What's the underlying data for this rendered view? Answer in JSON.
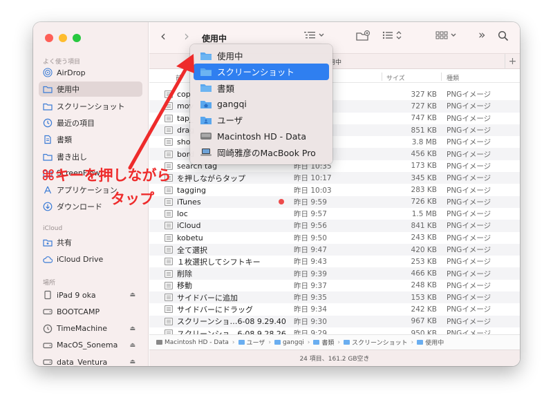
{
  "sidebar": {
    "favorites_title": "よく使う項目",
    "favorites": [
      {
        "label": "AirDrop",
        "icon": "airdrop-icon"
      },
      {
        "label": "使用中",
        "icon": "folder-icon",
        "selected": true
      },
      {
        "label": "スクリーンショット",
        "icon": "folder-icon"
      },
      {
        "label": "最近の項目",
        "icon": "clock-icon"
      },
      {
        "label": "書類",
        "icon": "document-icon"
      },
      {
        "label": "書き出し",
        "icon": "folder-icon"
      },
      {
        "label": "ScreenFlow",
        "icon": "folder-icon"
      },
      {
        "label": "アプリケーション",
        "icon": "applications-icon"
      },
      {
        "label": "ダウンロード",
        "icon": "download-icon"
      }
    ],
    "icloud_title": "iCloud",
    "icloud": [
      {
        "label": "共有",
        "icon": "shared-folder-icon"
      },
      {
        "label": "iCloud Drive",
        "icon": "cloud-icon"
      }
    ],
    "locations_title": "場所",
    "locations": [
      {
        "label": "iPad 9 oka",
        "icon": "ipad-icon",
        "eject": "⏏"
      },
      {
        "label": "BOOTCAMP",
        "icon": "drive-icon",
        "eject": ""
      },
      {
        "label": "TimeMachine",
        "icon": "timemachine-icon",
        "eject": "⏏"
      },
      {
        "label": "MacOS_Sonema",
        "icon": "drive-icon",
        "eject": "⏏"
      },
      {
        "label": "data_Ventura",
        "icon": "drive-icon",
        "eject": "⏏"
      }
    ]
  },
  "toolbar": {
    "back": "‹",
    "forward": "›",
    "title": "使用中",
    "more": "»"
  },
  "tabbar": {
    "label": "用中",
    "plus": "+"
  },
  "columns": {
    "name": "前",
    "size": "サイズ",
    "kind": "種類"
  },
  "files": [
    {
      "name": "cop",
      "date": "",
      "size": "327 KB",
      "kind": "PNGイメージ"
    },
    {
      "name": "mov",
      "date": "",
      "size": "727 KB",
      "kind": "PNGイメージ"
    },
    {
      "name": "tap_",
      "date": "",
      "size": "747 KB",
      "kind": "PNGイメージ"
    },
    {
      "name": "drag",
      "date": "",
      "size": "851 KB",
      "kind": "PNGイメージ"
    },
    {
      "name": "sho",
      "date": "",
      "size": "3.8 MB",
      "kind": "PNGイメージ"
    },
    {
      "name": "bord",
      "date": "",
      "size": "456 KB",
      "kind": "PNGイメージ"
    },
    {
      "name": "search tag",
      "date": "昨日 10:35",
      "size": "173 KB",
      "kind": "PNGイメージ"
    },
    {
      "name": "を押しながらタップ",
      "date": "昨日 10:17",
      "size": "345 KB",
      "kind": "PNGイメージ"
    },
    {
      "name": "tagging",
      "date": "昨日 10:03",
      "size": "283 KB",
      "kind": "PNGイメージ"
    },
    {
      "name": "iTunes",
      "date": "昨日 9:59",
      "size": "726 KB",
      "kind": "PNGイメージ",
      "tag": true
    },
    {
      "name": "loc",
      "date": "昨日 9:57",
      "size": "1.5 MB",
      "kind": "PNGイメージ"
    },
    {
      "name": "iCloud",
      "date": "昨日 9:56",
      "size": "841 KB",
      "kind": "PNGイメージ"
    },
    {
      "name": "kobetu",
      "date": "昨日 9:50",
      "size": "243 KB",
      "kind": "PNGイメージ"
    },
    {
      "name": "全て選択",
      "date": "昨日 9:47",
      "size": "420 KB",
      "kind": "PNGイメージ"
    },
    {
      "name": "１枚選択してシフトキー",
      "date": "昨日 9:43",
      "size": "253 KB",
      "kind": "PNGイメージ"
    },
    {
      "name": "削除",
      "date": "昨日 9:39",
      "size": "466 KB",
      "kind": "PNGイメージ"
    },
    {
      "name": "移動",
      "date": "昨日 9:37",
      "size": "248 KB",
      "kind": "PNGイメージ"
    },
    {
      "name": "サイドバーに追加",
      "date": "昨日 9:35",
      "size": "153 KB",
      "kind": "PNGイメージ"
    },
    {
      "name": "サイドバーにドラッグ",
      "date": "昨日 9:34",
      "size": "242 KB",
      "kind": "PNGイメージ"
    },
    {
      "name": "スクリーンショ…6-08 9.29.40",
      "date": "昨日 9:30",
      "size": "967 KB",
      "kind": "PNGイメージ"
    },
    {
      "name": "スクリーンショ…6-08 9.28.26",
      "date": "昨日 9:29",
      "size": "950 KB",
      "kind": "PNGイメージ"
    }
  ],
  "pathbar": [
    {
      "label": "Macintosh HD - Data",
      "type": "drive"
    },
    {
      "label": "ユーザ",
      "type": "folder"
    },
    {
      "label": "gangqi",
      "type": "folder"
    },
    {
      "label": "書類",
      "type": "folder"
    },
    {
      "label": "スクリーンショット",
      "type": "folder"
    },
    {
      "label": "使用中",
      "type": "folder"
    }
  ],
  "status": "24 項目、161.2 GB空き",
  "dropdown": [
    {
      "label": "使用中",
      "icon": "folder-icon"
    },
    {
      "label": "スクリーンショット",
      "icon": "folder-icon",
      "active": true
    },
    {
      "label": "書類",
      "icon": "folder-icon"
    },
    {
      "label": "gangqi",
      "icon": "home-folder-icon"
    },
    {
      "label": "ユーザ",
      "icon": "users-folder-icon"
    },
    {
      "label": "Macintosh HD - Data",
      "icon": "drive-icon"
    },
    {
      "label": "岡崎雅彦のMacBook Pro",
      "icon": "laptop-icon"
    }
  ],
  "annotation": {
    "line1": "⌘キーを押しながら",
    "line2": "タップ",
    "color": "#ee2b2b"
  }
}
